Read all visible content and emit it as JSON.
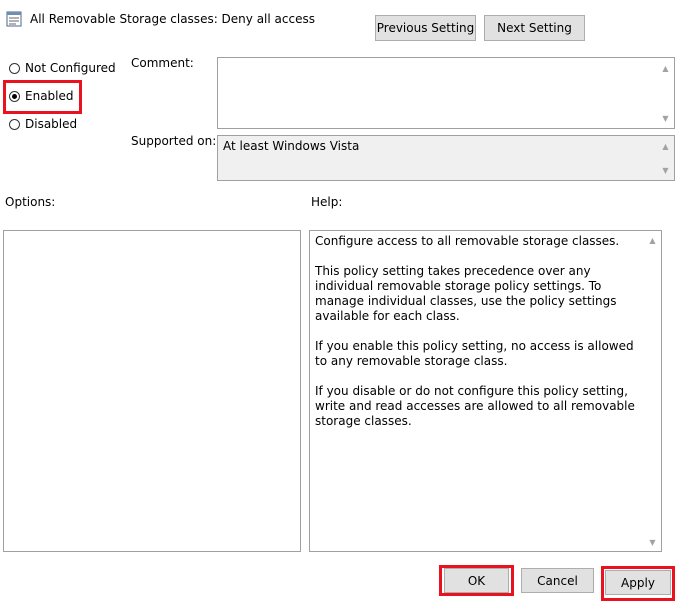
{
  "dialog": {
    "title": "All Removable Storage classes: Deny all access"
  },
  "nav": {
    "previous_label": "Previous Setting",
    "next_label": "Next Setting"
  },
  "state": {
    "options": [
      {
        "label": "Not Configured",
        "checked": false
      },
      {
        "label": "Enabled",
        "checked": true
      },
      {
        "label": "Disabled",
        "checked": false
      }
    ]
  },
  "comment": {
    "label": "Comment:",
    "value": ""
  },
  "supported": {
    "label": "Supported on:",
    "value": "At least Windows Vista"
  },
  "options_panel": {
    "label": "Options:"
  },
  "help_panel": {
    "label": "Help:",
    "paragraphs": [
      "Configure access to all removable storage classes.",
      "This policy setting takes precedence over any individual removable storage policy settings. To manage individual classes, use the policy settings available for each class.",
      "If you enable this policy setting, no access is allowed to any removable storage class.",
      "If you disable or do not configure this policy setting, write and read accesses are allowed to all removable storage classes."
    ]
  },
  "footer": {
    "ok_label": "OK",
    "cancel_label": "Cancel",
    "apply_label": "Apply"
  },
  "colors": {
    "highlight": "#e8131f",
    "button_bg": "#e1e1e1"
  }
}
